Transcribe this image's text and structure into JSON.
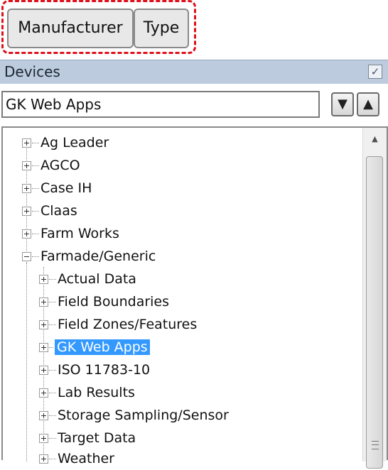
{
  "tabs": [
    {
      "label": "Manufacturer"
    },
    {
      "label": "Type"
    }
  ],
  "devices": {
    "title": "Devices",
    "check_glyph": "✓",
    "filter_value": "GK Web Apps",
    "down_glyph": "▼",
    "up_glyph": "▲"
  },
  "tree": {
    "top_level": [
      {
        "label": "Ag Leader",
        "expanded": false
      },
      {
        "label": "AGCO",
        "expanded": false
      },
      {
        "label": "Case IH",
        "expanded": false
      },
      {
        "label": "Claas",
        "expanded": false
      },
      {
        "label": "Farm Works",
        "expanded": false
      },
      {
        "label": "Farmade/Generic",
        "expanded": true
      }
    ],
    "children": [
      {
        "label": "Actual Data"
      },
      {
        "label": "Field Boundaries"
      },
      {
        "label": "Field Zones/Features"
      },
      {
        "label": "GK Web Apps",
        "selected": true
      },
      {
        "label": "ISO 11783-10"
      },
      {
        "label": "Lab Results"
      },
      {
        "label": "Storage Sampling/Sensor"
      },
      {
        "label": "Target Data"
      },
      {
        "label": "Weather"
      }
    ]
  },
  "scrollbar": {
    "up_glyph": "▲"
  },
  "colors": {
    "highlight_dash": "#e0101a",
    "header_bg": "#bccbdd",
    "selection": "#3399ff"
  }
}
